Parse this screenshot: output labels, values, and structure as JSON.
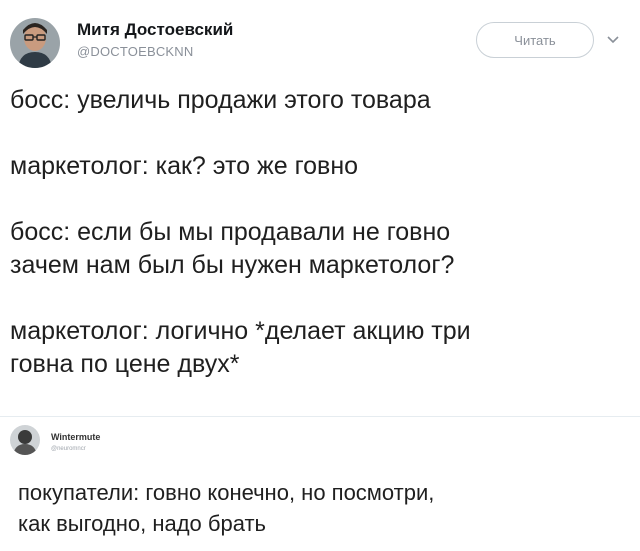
{
  "tweet": {
    "author": {
      "name": "Митя Достоевский",
      "handle": "@DOCTOEBCKNN"
    },
    "follow_label": "Читать",
    "lines": [
      "босс: увеличь продажи этого товара",
      "",
      "маркетолог: как? это же говно",
      "",
      "босс: если бы мы продавали не говно",
      "зачем нам был бы нужен маркетолог?",
      "",
      "маркетолог: логично *делает акцию три",
      "говна по цене двух*"
    ]
  },
  "reply": {
    "author": {
      "name": "Wintermute",
      "handle": "@neuromncr"
    },
    "lines": [
      "покупатели: говно конечно, но посмотри,",
      "как выгодно, надо брать"
    ]
  },
  "colors": {
    "background": "#ffffff",
    "text": "#1f1f1f",
    "muted": "#8a9099",
    "border": "#c9d0d6"
  }
}
